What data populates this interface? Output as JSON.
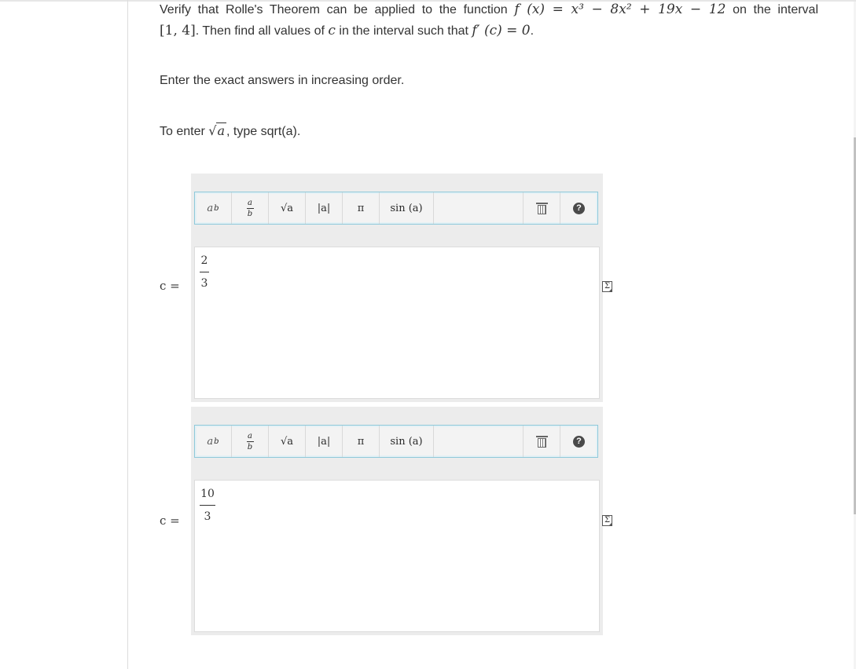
{
  "question": {
    "line1_prefix": "Verify that Rolle's Theorem can be applied to the function ",
    "function_lhs": "f (x) = ",
    "function_rhs": "x³ − 8x² + 19x − 12",
    "line1_suffix": " on the interval",
    "interval": "[1, 4]",
    "line2_text": ". Then find all values of ",
    "c_var": "c",
    "line2_mid": " in the interval such that ",
    "derivative_eq": "f′ (c) = 0",
    "line2_end": "."
  },
  "instructions": {
    "order": "Enter the exact answers in increasing order.",
    "sqrt_prefix": "To enter ",
    "sqrt_symbol": "√",
    "sqrt_arg": "a",
    "sqrt_suffix": ", type sqrt(a)."
  },
  "toolbar": {
    "power_base": "a",
    "power_exp": "b",
    "frac_num": "a",
    "frac_den": "b",
    "sqrt_label": "√a",
    "abs_label": "|a|",
    "pi_label": "π",
    "sin_label": "sin (a)",
    "help_label": "?"
  },
  "answers": [
    {
      "label": "c =",
      "numerator": "2",
      "denominator": "3"
    },
    {
      "label": "c =",
      "numerator": "10",
      "denominator": "3"
    }
  ],
  "formula_icon_glyph": "Σ"
}
